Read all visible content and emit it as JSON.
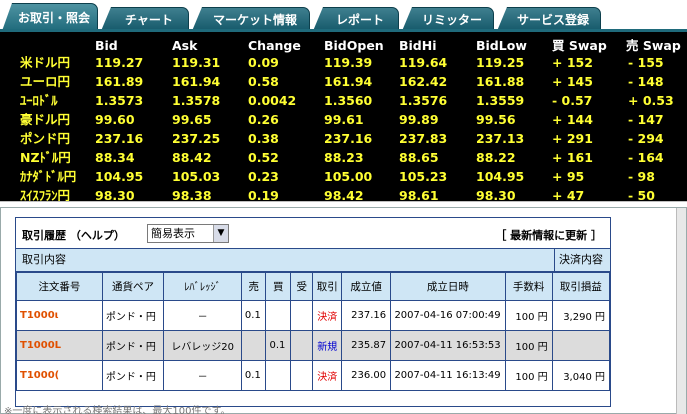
{
  "tabs": [
    {
      "label": "お取引・照会",
      "active": true
    },
    {
      "label": "チャート",
      "active": false
    },
    {
      "label": "マーケット情報",
      "active": false
    },
    {
      "label": "レポート",
      "active": false
    },
    {
      "label": "リミッター",
      "active": false
    },
    {
      "label": "サービス登録",
      "active": false
    }
  ],
  "rates": {
    "headers": [
      "Bid",
      "Ask",
      "Change",
      "BidOpen",
      "BidHi",
      "BidLow",
      "買 Swap",
      "売 Swap"
    ],
    "rows": [
      {
        "pair": "米ドル円",
        "bid": "119.27",
        "ask": "119.31",
        "change": "0.09",
        "bidopen": "119.39",
        "bidhi": "119.64",
        "bidlow": "119.25",
        "buy_swap": "+ 152",
        "sell_swap": "- 155"
      },
      {
        "pair": "ユーロ円",
        "bid": "161.89",
        "ask": "161.94",
        "change": "0.58",
        "bidopen": "161.94",
        "bidhi": "162.42",
        "bidlow": "161.88",
        "buy_swap": "+ 145",
        "sell_swap": "- 148"
      },
      {
        "pair": "ﾕｰﾛﾄﾞﾙ",
        "bid": "1.3573",
        "ask": "1.3578",
        "change": "0.0042",
        "bidopen": "1.3560",
        "bidhi": "1.3576",
        "bidlow": "1.3559",
        "buy_swap": "- 0.57",
        "sell_swap": "+ 0.53"
      },
      {
        "pair": "豪ドル円",
        "bid": "99.60",
        "ask": "99.65",
        "change": "0.26",
        "bidopen": "99.61",
        "bidhi": "99.89",
        "bidlow": "99.56",
        "buy_swap": "+ 144",
        "sell_swap": "- 147"
      },
      {
        "pair": "ポンド円",
        "bid": "237.16",
        "ask": "237.25",
        "change": "0.38",
        "bidopen": "237.16",
        "bidhi": "237.83",
        "bidlow": "237.13",
        "buy_swap": "+ 291",
        "sell_swap": "- 294"
      },
      {
        "pair": "NZﾄﾞﾙ円",
        "bid": "88.34",
        "ask": "88.42",
        "change": "0.52",
        "bidopen": "88.23",
        "bidhi": "88.65",
        "bidlow": "88.22",
        "buy_swap": "+ 161",
        "sell_swap": "- 164"
      },
      {
        "pair": "ｶﾅﾀﾞﾄﾞﾙ円",
        "bid": "104.95",
        "ask": "105.03",
        "change": "0.23",
        "bidopen": "105.00",
        "bidhi": "105.23",
        "bidlow": "104.95",
        "buy_swap": "+ 95",
        "sell_swap": "- 98"
      },
      {
        "pair": "ｽｲｽﾌﾗﾝ円",
        "bid": "98.30",
        "ask": "98.38",
        "change": "0.19",
        "bidopen": "98.42",
        "bidhi": "98.61",
        "bidlow": "98.30",
        "buy_swap": "+ 47",
        "sell_swap": "- 50"
      }
    ]
  },
  "history": {
    "title": "取引履歴 （ヘルプ）",
    "view_select": "簡易表示",
    "refresh_label": "［ 最新情報に更新 ］",
    "section_left": "取引内容",
    "section_right": "決済内容",
    "columns": [
      "注文番号",
      "通貨ペア",
      "ﾚﾊﾞﾚｯｼﾞ",
      "売",
      "買",
      "受",
      "取引",
      "成立値",
      "成立日時",
      "手数料",
      "取引損益"
    ],
    "rows": [
      {
        "order": "T1000ι",
        "pair": "ポンド・円",
        "leverage": "－",
        "sell": "0.1",
        "buy": "",
        "recv": "",
        "type": "決済",
        "price": "237.16",
        "datetime": "2007-04-16 07:00:49",
        "fee": "100 円",
        "pl": "3,290 円"
      },
      {
        "order": "T1000L",
        "pair": "ポンド・円",
        "leverage": "レバレッジ20",
        "sell": "",
        "buy": "0.1",
        "recv": "",
        "type": "新規",
        "price": "235.87",
        "datetime": "2007-04-11 16:53:53",
        "fee": "100 円",
        "pl": ""
      },
      {
        "order": "T1000(",
        "pair": "ポンド・円",
        "leverage": "－",
        "sell": "0.1",
        "buy": "",
        "recv": "",
        "type": "決済",
        "price": "236.00",
        "datetime": "2007-04-11 16:13:49",
        "fee": "100 円",
        "pl": "3,040 円"
      }
    ]
  },
  "footnote": "※一度に表示される検索結果は、最大100件です。",
  "colors": {
    "tab": "#1f6a7b",
    "board_bg": "#000000",
    "board_value": "#ffff33",
    "grid_header": "#cfe6f5",
    "order_no": "#e05000",
    "settle": "#e00000",
    "new": "#0000d0"
  }
}
